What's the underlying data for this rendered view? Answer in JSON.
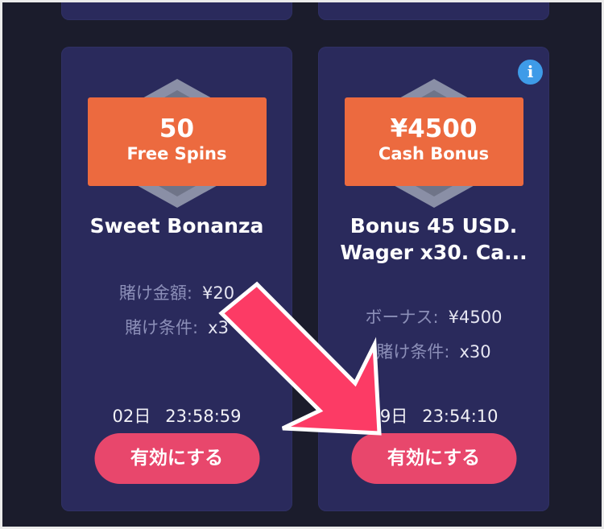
{
  "cards": [
    {
      "badge_amount": "50",
      "badge_type": "Free Spins",
      "title_line1": "Sweet Bonanza",
      "rows": [
        {
          "label": "賭け金額:",
          "value": "¥20"
        },
        {
          "label": "賭け条件:",
          "value": "x3"
        }
      ],
      "timer_days": "02日",
      "timer_time": "23:58:59",
      "button_label": "有効にする"
    },
    {
      "badge_amount": "¥4500",
      "badge_type": "Cash Bonus",
      "title_line1": "Bonus 45 USD.",
      "title_line2": "Wager x30. Ca...",
      "rows": [
        {
          "label": "ボーナス:",
          "value": "¥4500"
        },
        {
          "label": "賭け条件:",
          "value": "x30"
        }
      ],
      "timer_days": "29日",
      "timer_time": "23:54:10",
      "button_label": "有効にする",
      "info_icon": "i"
    }
  ],
  "colors": {
    "card_bg": "#2a2a5c",
    "badge": "#ec6a3f",
    "button": "#e8476c",
    "arrow": "#fc3b65",
    "info": "#3e9be8"
  },
  "annotation": {
    "icon": "arrow-down-right-icon"
  }
}
